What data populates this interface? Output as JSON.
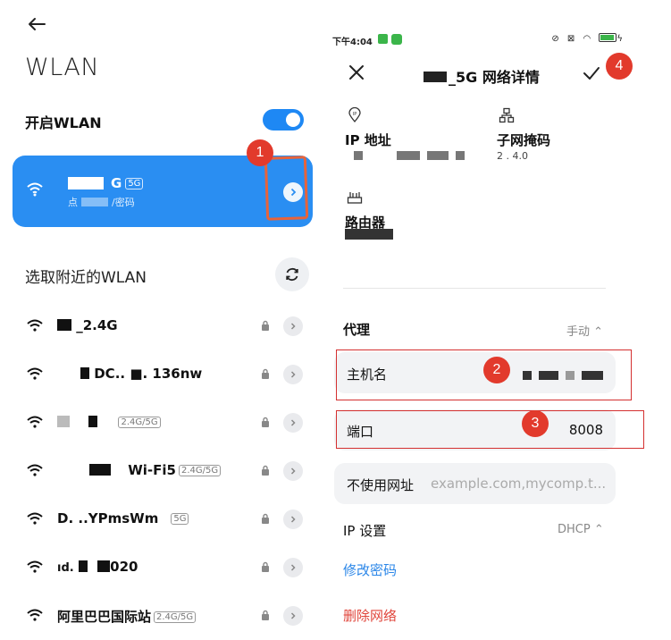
{
  "left": {
    "title": "WLAN",
    "toggle_label": "开启WLAN",
    "connected": {
      "ssid_suffix": "G",
      "band": "5G",
      "subtitle_prefix": "点",
      "subtitle_suffix": "/密码"
    },
    "nearby_title": "选取附近的WLAN",
    "networks": [
      {
        "name": "_2.4G",
        "tag": ""
      },
      {
        "name": "DC.. ■. 136nw",
        "tag": ""
      },
      {
        "name": "",
        "tag": "2.4G/5G"
      },
      {
        "name": "Wi-Fi5",
        "tag": "2.4G/5G"
      },
      {
        "name": "D.      ..YPmsWm",
        "tag": "5G"
      },
      {
        "name": "020",
        "tag": ""
      },
      {
        "name": "阿里巴巴国际站",
        "tag": "2.4G/5G"
      }
    ]
  },
  "right": {
    "status": {
      "time": "下午4:04"
    },
    "title_suffix": "_5G 网络详情",
    "ip_label": "IP 地址",
    "subnet_label": "子网掩码",
    "subnet_value": "2    .  4.0",
    "router_label": "路由器",
    "proxy_label": "代理",
    "proxy_value": "手动 ⌃",
    "hostname_label": "主机名",
    "port_label": "端口",
    "port_value": "8008",
    "bypass_label": "不使用网址",
    "bypass_placeholder": "example.com,mycomp.t...",
    "ip_settings_label": "IP 设置",
    "ip_settings_value": "DHCP ⌃",
    "change_password": "修改密码",
    "delete_network": "删除网络"
  },
  "annotations": {
    "b1": "1",
    "b2": "2",
    "b3": "3",
    "b4": "4"
  },
  "colors": {
    "accent": "#2a8ef2",
    "badge": "#e23a2c",
    "link_blue": "#2a86e8",
    "link_red": "#e0453b"
  }
}
